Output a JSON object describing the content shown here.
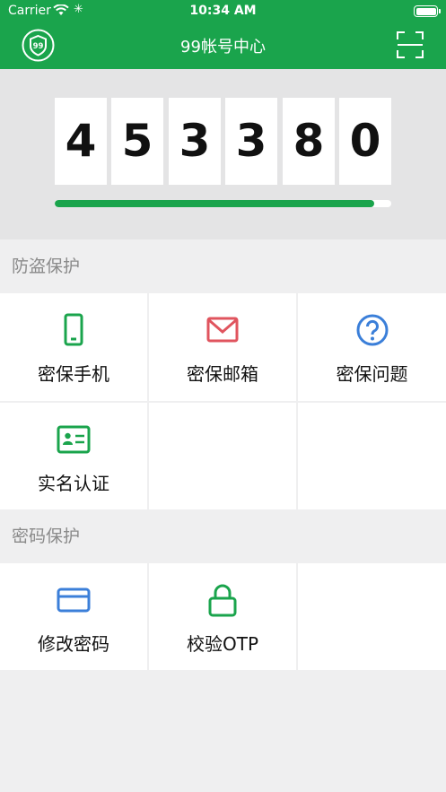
{
  "status_bar": {
    "carrier": "Carrier",
    "time": "10:34 AM"
  },
  "nav": {
    "title": "99帐号中心",
    "logo_icon": "99-logo-icon",
    "scan_icon": "scan-icon"
  },
  "otp": {
    "digits": [
      "4",
      "5",
      "3",
      "3",
      "8",
      "0"
    ],
    "progress_fraction": 0.95,
    "progress_color": "#1aa44c"
  },
  "sections": [
    {
      "title": "防盗保护",
      "items": [
        {
          "label": "密保手机",
          "icon": "phone-icon",
          "color": "#1aa44c"
        },
        {
          "label": "密保邮箱",
          "icon": "mail-icon",
          "color": "#e0545e"
        },
        {
          "label": "密保问题",
          "icon": "question-icon",
          "color": "#3b7fd9"
        },
        {
          "label": "实名认证",
          "icon": "id-card-icon",
          "color": "#1aa44c"
        }
      ]
    },
    {
      "title": "密码保护",
      "items": [
        {
          "label": "修改密码",
          "icon": "card-icon",
          "color": "#3b7fd9"
        },
        {
          "label": "校验OTP",
          "icon": "lock-icon",
          "color": "#1aa44c"
        }
      ]
    }
  ],
  "colors": {
    "brand": "#1aa44c",
    "background": "#efeff0"
  }
}
